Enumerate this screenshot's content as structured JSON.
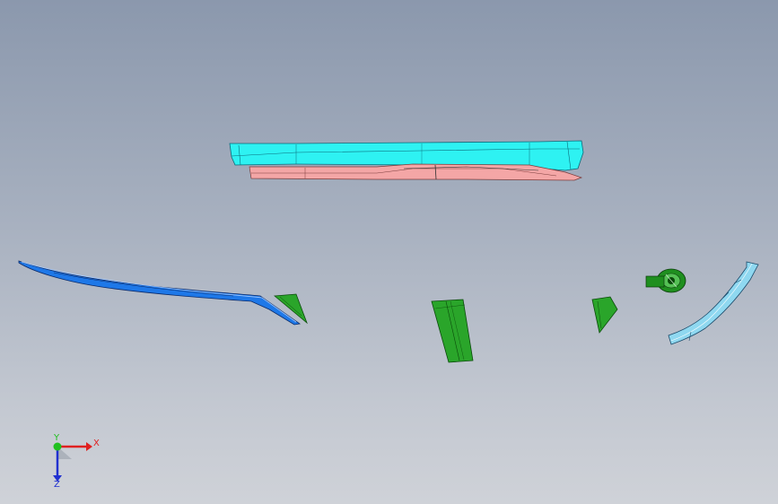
{
  "viewport": {
    "background_top": "#8b98ad",
    "background_bottom": "#cfd2d8"
  },
  "parts": [
    {
      "name": "side-sill-cover",
      "color": "#2ef2f2"
    },
    {
      "name": "sill-inner-panel",
      "color": "#f2a3a3"
    },
    {
      "name": "long-trim-strip",
      "color": "#1e78e8"
    },
    {
      "name": "small-bracket-left",
      "color": "#2aa52a"
    },
    {
      "name": "center-bracket",
      "color": "#2aa52a"
    },
    {
      "name": "small-bracket-right",
      "color": "#2aa52a"
    },
    {
      "name": "clip-assembly",
      "color": "#1f8f1f"
    },
    {
      "name": "curved-end-trim",
      "color": "#8fd8f0"
    }
  ],
  "triad": {
    "x_label": "X",
    "y_label": "Y",
    "z_label": "Z",
    "x_color": "#e02020",
    "y_color": "#20c020",
    "z_color": "#2030d0"
  }
}
